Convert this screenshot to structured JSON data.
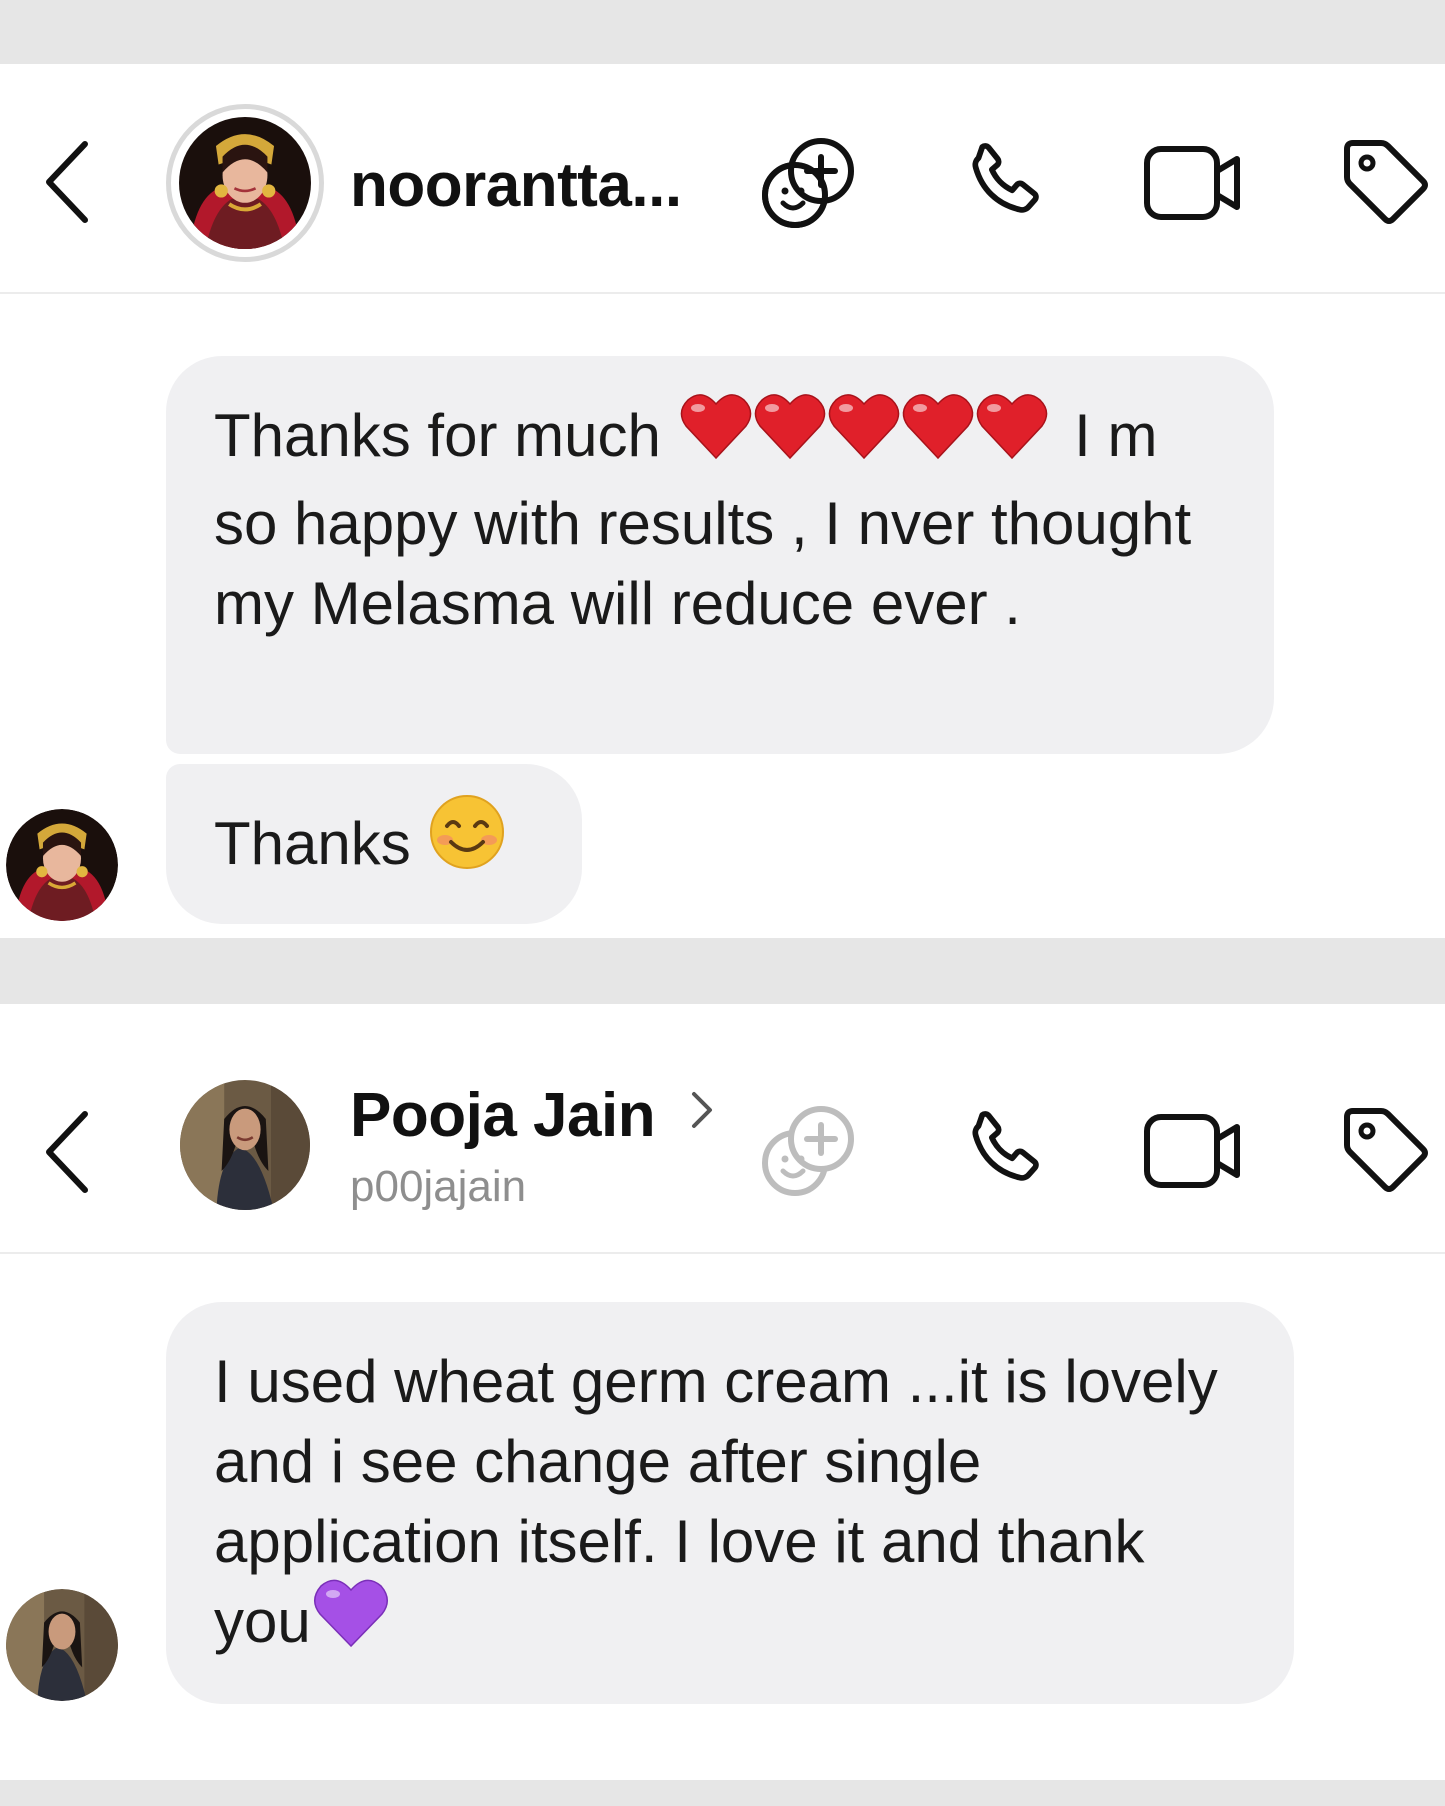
{
  "chat_one": {
    "contact_name": "noorantta...",
    "messages": [
      {
        "text_before": "Thanks for much",
        "emoji": "red-heart x5",
        "text_after": " I m so happy with results , I nver thought my Melasma will reduce ever ."
      },
      {
        "text": "Thanks",
        "emoji": "smiling-face"
      }
    ]
  },
  "chat_two": {
    "contact_name": "Pooja Jain",
    "contact_username": "p00jajain",
    "messages": [
      {
        "text": "I used wheat germ cream ...it is lovely and i see change after single application itself. I love it and thank you",
        "emoji": "purple-heart"
      }
    ]
  },
  "colors": {
    "bubble": "#f0f0f2",
    "band": "#e6e6e6",
    "heart_red": "#e0202a",
    "heart_purple": "#a550e6",
    "smiley": "#f7c334"
  }
}
